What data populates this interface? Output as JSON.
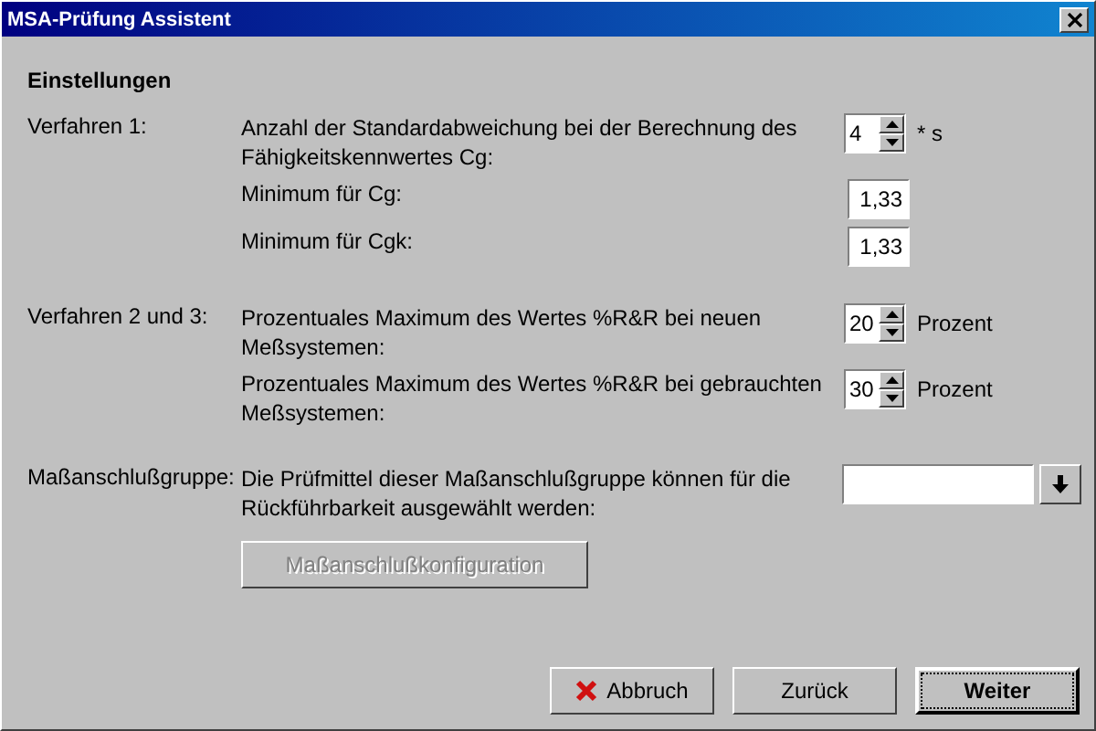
{
  "window": {
    "title": "MSA-Prüfung Assistent"
  },
  "heading": "Einstellungen",
  "groups": [
    {
      "label": "Verfahren 1:",
      "rows": [
        {
          "kind": "spinner",
          "text": "Anzahl der Standardabweichung bei der Berechnung des Fähigkeitskennwertes Cg:",
          "value": "4",
          "unit": "* s"
        },
        {
          "kind": "field",
          "text": "Minimum für Cg:",
          "value": "1,33"
        },
        {
          "kind": "field",
          "text": "Minimum für Cgk:",
          "value": "1,33"
        }
      ]
    },
    {
      "label": "Verfahren 2 und 3:",
      "rows": [
        {
          "kind": "spinner",
          "text": "Prozentuales Maximum des Wertes %R&R bei neuen Meßsystemen:",
          "value": "20",
          "unit": "Prozent"
        },
        {
          "kind": "spinner",
          "text": "Prozentuales Maximum des Wertes %R&R bei gebrauchten Meßsystemen:",
          "value": "30",
          "unit": "Prozent"
        }
      ]
    },
    {
      "label": "Maßanschlußgruppe:",
      "rows": [
        {
          "kind": "combo",
          "text": "Die Prüfmittel dieser Maßanschlußgruppe können für die Rückführbarkeit ausgewählt werden:",
          "button": {
            "label": "Maßanschlußkonfiguration",
            "disabled": true
          }
        }
      ]
    }
  ],
  "buttons": [
    {
      "label": "Abbruch",
      "kind": "cancel",
      "default": false
    },
    {
      "label": "Zurück",
      "kind": "plain",
      "default": false
    },
    {
      "label": "Weiter",
      "kind": "plain",
      "default": true
    }
  ]
}
